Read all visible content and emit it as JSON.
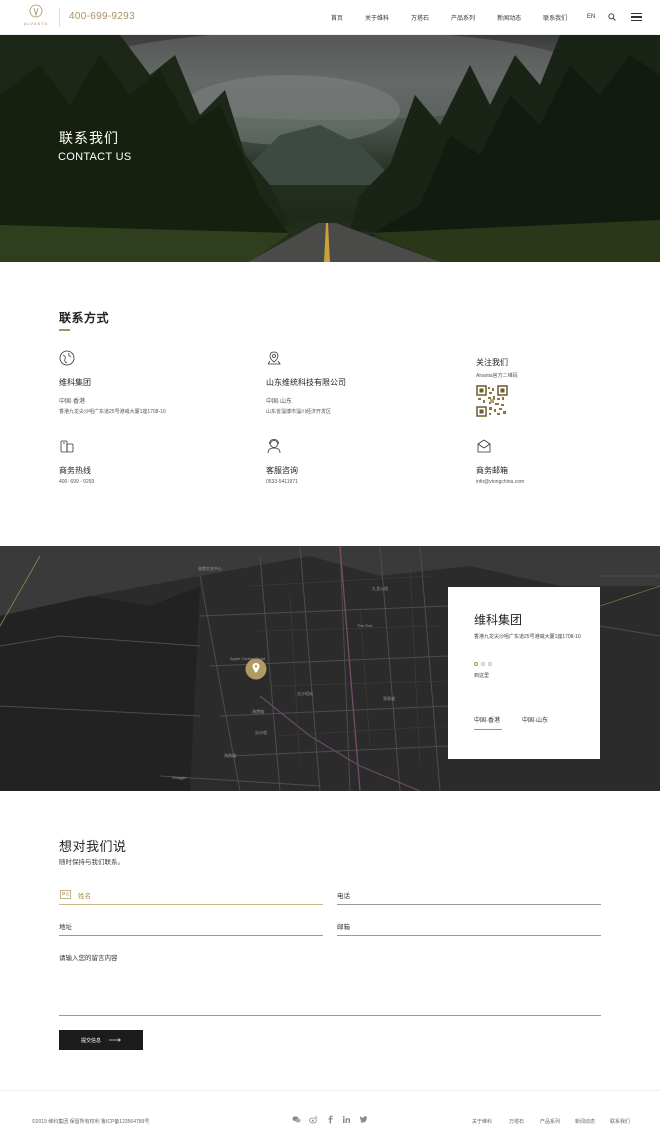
{
  "header": {
    "logo_text": "ALVANTA",
    "phone": "400-699-9293",
    "nav": [
      "首页",
      "关于维科",
      "万塔石",
      "产品系列",
      "新闻动态",
      "联系我们"
    ],
    "lang": "EN"
  },
  "hero": {
    "title": "联系我们",
    "subtitle": "CONTACT US"
  },
  "contact": {
    "section_title": "联系方式",
    "blocks": [
      {
        "name": "维科集团",
        "line1": "中国·香港",
        "line2": "香港九龙尖沙咀广东道25号港威大厦1座1708-10",
        "icon": "globe-icon"
      },
      {
        "name": "山东维统科技有限公司",
        "line1": "中国·山东",
        "line2": "山东省淄博市淄川经济开发区",
        "icon": "location-pin-icon"
      },
      {
        "name": "商务热线",
        "line1": "400- 699 - 9293",
        "icon": "phone-icon"
      },
      {
        "name": "客服咨询",
        "line1": "0533-5411971",
        "icon": "customer-service-icon"
      },
      {
        "name": "商务邮箱",
        "line1": "info@vtongchina.com",
        "icon": "mail-icon"
      }
    ],
    "follow_title": "关注我们",
    "follow_sub": "Alvanta官方二维码"
  },
  "map": {
    "card_title": "维科集团",
    "card_address": "香港九龙尖沙咀广东道25号港威大厦1座1708-10",
    "card_goto": "到这里",
    "tabs": [
      "中国·香港",
      "中国·山东"
    ],
    "labels": [
      "Apple Canton Road",
      "海港城",
      "尖沙咀",
      "Smiggle",
      "九龙公园",
      "香港文化中心",
      "The One",
      "尖沙咀站",
      "海防道",
      "弥敦道"
    ]
  },
  "form": {
    "title": "想对我们说",
    "subtitle": "随时保持与我们联系。",
    "fields": {
      "name": "姓名",
      "phone": "电话",
      "address": "地址",
      "email": "邮箱",
      "message": "请输入您的留言内容"
    },
    "submit": "提交信息"
  },
  "footer": {
    "copyright": "©2019 维科集团 保留所有权利  鲁ICP备123564789号",
    "links": [
      "关于维科",
      "万塔石",
      "产品系列",
      "新闻动态",
      "联系我们"
    ]
  },
  "colors": {
    "accent": "#a8925f",
    "dark": "#1c1c1c"
  }
}
